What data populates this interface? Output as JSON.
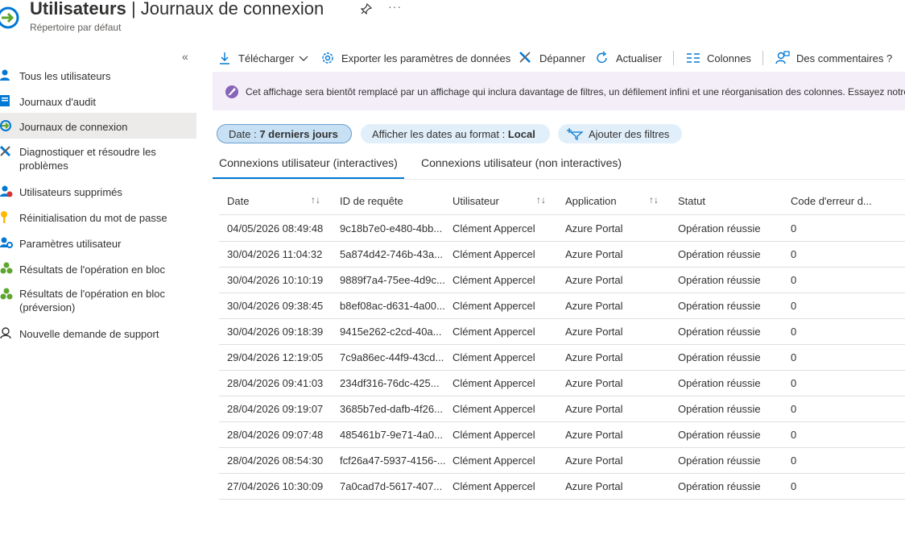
{
  "header": {
    "title_bold": "Utilisateurs",
    "title_rest": " | Journaux de connexion",
    "subtitle": "Répertoire par défaut",
    "pin_icon": "pin-icon",
    "more": "···"
  },
  "sidebar": {
    "collapse": "«",
    "items": [
      {
        "label": "Tous les utilisateurs",
        "icon": "user-icon"
      },
      {
        "label": "Journaux d'audit",
        "icon": "audit-log-icon"
      },
      {
        "label": "Journaux de connexion",
        "icon": "sign-in-icon",
        "active": true
      },
      {
        "label": "Diagnostiquer et résoudre les problèmes",
        "icon": "wrench-icon"
      },
      {
        "label": "Utilisateurs supprimés",
        "icon": "deleted-user-icon"
      },
      {
        "label": "Réinitialisation du mot de passe",
        "icon": "key-icon"
      },
      {
        "label": "Paramètres utilisateur",
        "icon": "user-settings-icon"
      },
      {
        "label": "Résultats de l'opération en bloc",
        "icon": "bulk-operation-icon"
      },
      {
        "label": "Résultats de l'opération en bloc (préversion)",
        "icon": "bulk-operation-icon"
      },
      {
        "label": "Nouvelle demande de support",
        "icon": "support-icon"
      }
    ]
  },
  "toolbar": {
    "download": "Télécharger",
    "export": "Exporter les paramètres de données",
    "troubleshoot": "Dépanner",
    "refresh": "Actualiser",
    "columns": "Colonnes",
    "feedback": "Des commentaires ?"
  },
  "banner": {
    "text": "Cet affichage sera bientôt remplacé par un affichage qui inclura davantage de filtres, un défilement infini et une réorganisation des colonnes. Essayez notre"
  },
  "filters": {
    "date_label": "Date : ",
    "date_value": "7 derniers jours",
    "format_label": "Afficher les dates au format : ",
    "format_value": "Local",
    "add": "Ajouter des filtres"
  },
  "tabs": [
    "Connexions utilisateur (interactives)",
    "Connexions utilisateur (non interactives)"
  ],
  "table": {
    "columns": [
      "Date",
      "ID de requête",
      "Utilisateur",
      "Application",
      "Statut",
      "Code d'erreur d..."
    ],
    "sort_glyph": "↑↓",
    "rows": [
      [
        "04/05/2026 08:49:48",
        "9c18b7e0-e480-4bb...",
        "Clément Appercel",
        "Azure Portal",
        "Opération réussie",
        "0"
      ],
      [
        "30/04/2026 11:04:32",
        "5a874d42-746b-43a...",
        "Clément Appercel",
        "Azure Portal",
        "Opération réussie",
        "0"
      ],
      [
        "30/04/2026 10:10:19",
        "9889f7a4-75ee-4d9c...",
        "Clément Appercel",
        "Azure Portal",
        "Opération réussie",
        "0"
      ],
      [
        "30/04/2026 09:38:45",
        "b8ef08ac-d631-4a00...",
        "Clément Appercel",
        "Azure Portal",
        "Opération réussie",
        "0"
      ],
      [
        "30/04/2026 09:18:39",
        "9415e262-c2cd-40a...",
        "Clément Appercel",
        "Azure Portal",
        "Opération réussie",
        "0"
      ],
      [
        "29/04/2026 12:19:05",
        "7c9a86ec-44f9-43cd...",
        "Clément Appercel",
        "Azure Portal",
        "Opération réussie",
        "0"
      ],
      [
        "28/04/2026 09:41:03",
        "234df316-76dc-425...",
        "Clément Appercel",
        "Azure Portal",
        "Opération réussie",
        "0"
      ],
      [
        "28/04/2026 09:19:07",
        "3685b7ed-dafb-4f26...",
        "Clément Appercel",
        "Azure Portal",
        "Opération réussie",
        "0"
      ],
      [
        "28/04/2026 09:07:48",
        "485461b7-9e71-4a0...",
        "Clément Appercel",
        "Azure Portal",
        "Opération réussie",
        "0"
      ],
      [
        "28/04/2026 08:54:30",
        "fcf26a47-5937-4156-...",
        "Clément Appercel",
        "Azure Portal",
        "Opération réussie",
        "0"
      ],
      [
        "27/04/2026 10:30:09",
        "7a0cad7d-5617-407...",
        "Clément Appercel",
        "Azure Portal",
        "Opération réussie",
        "0"
      ]
    ]
  },
  "colors": {
    "accent": "#0078d4",
    "banner_bg": "#f3eef8",
    "active_nav": "#edebe9"
  }
}
